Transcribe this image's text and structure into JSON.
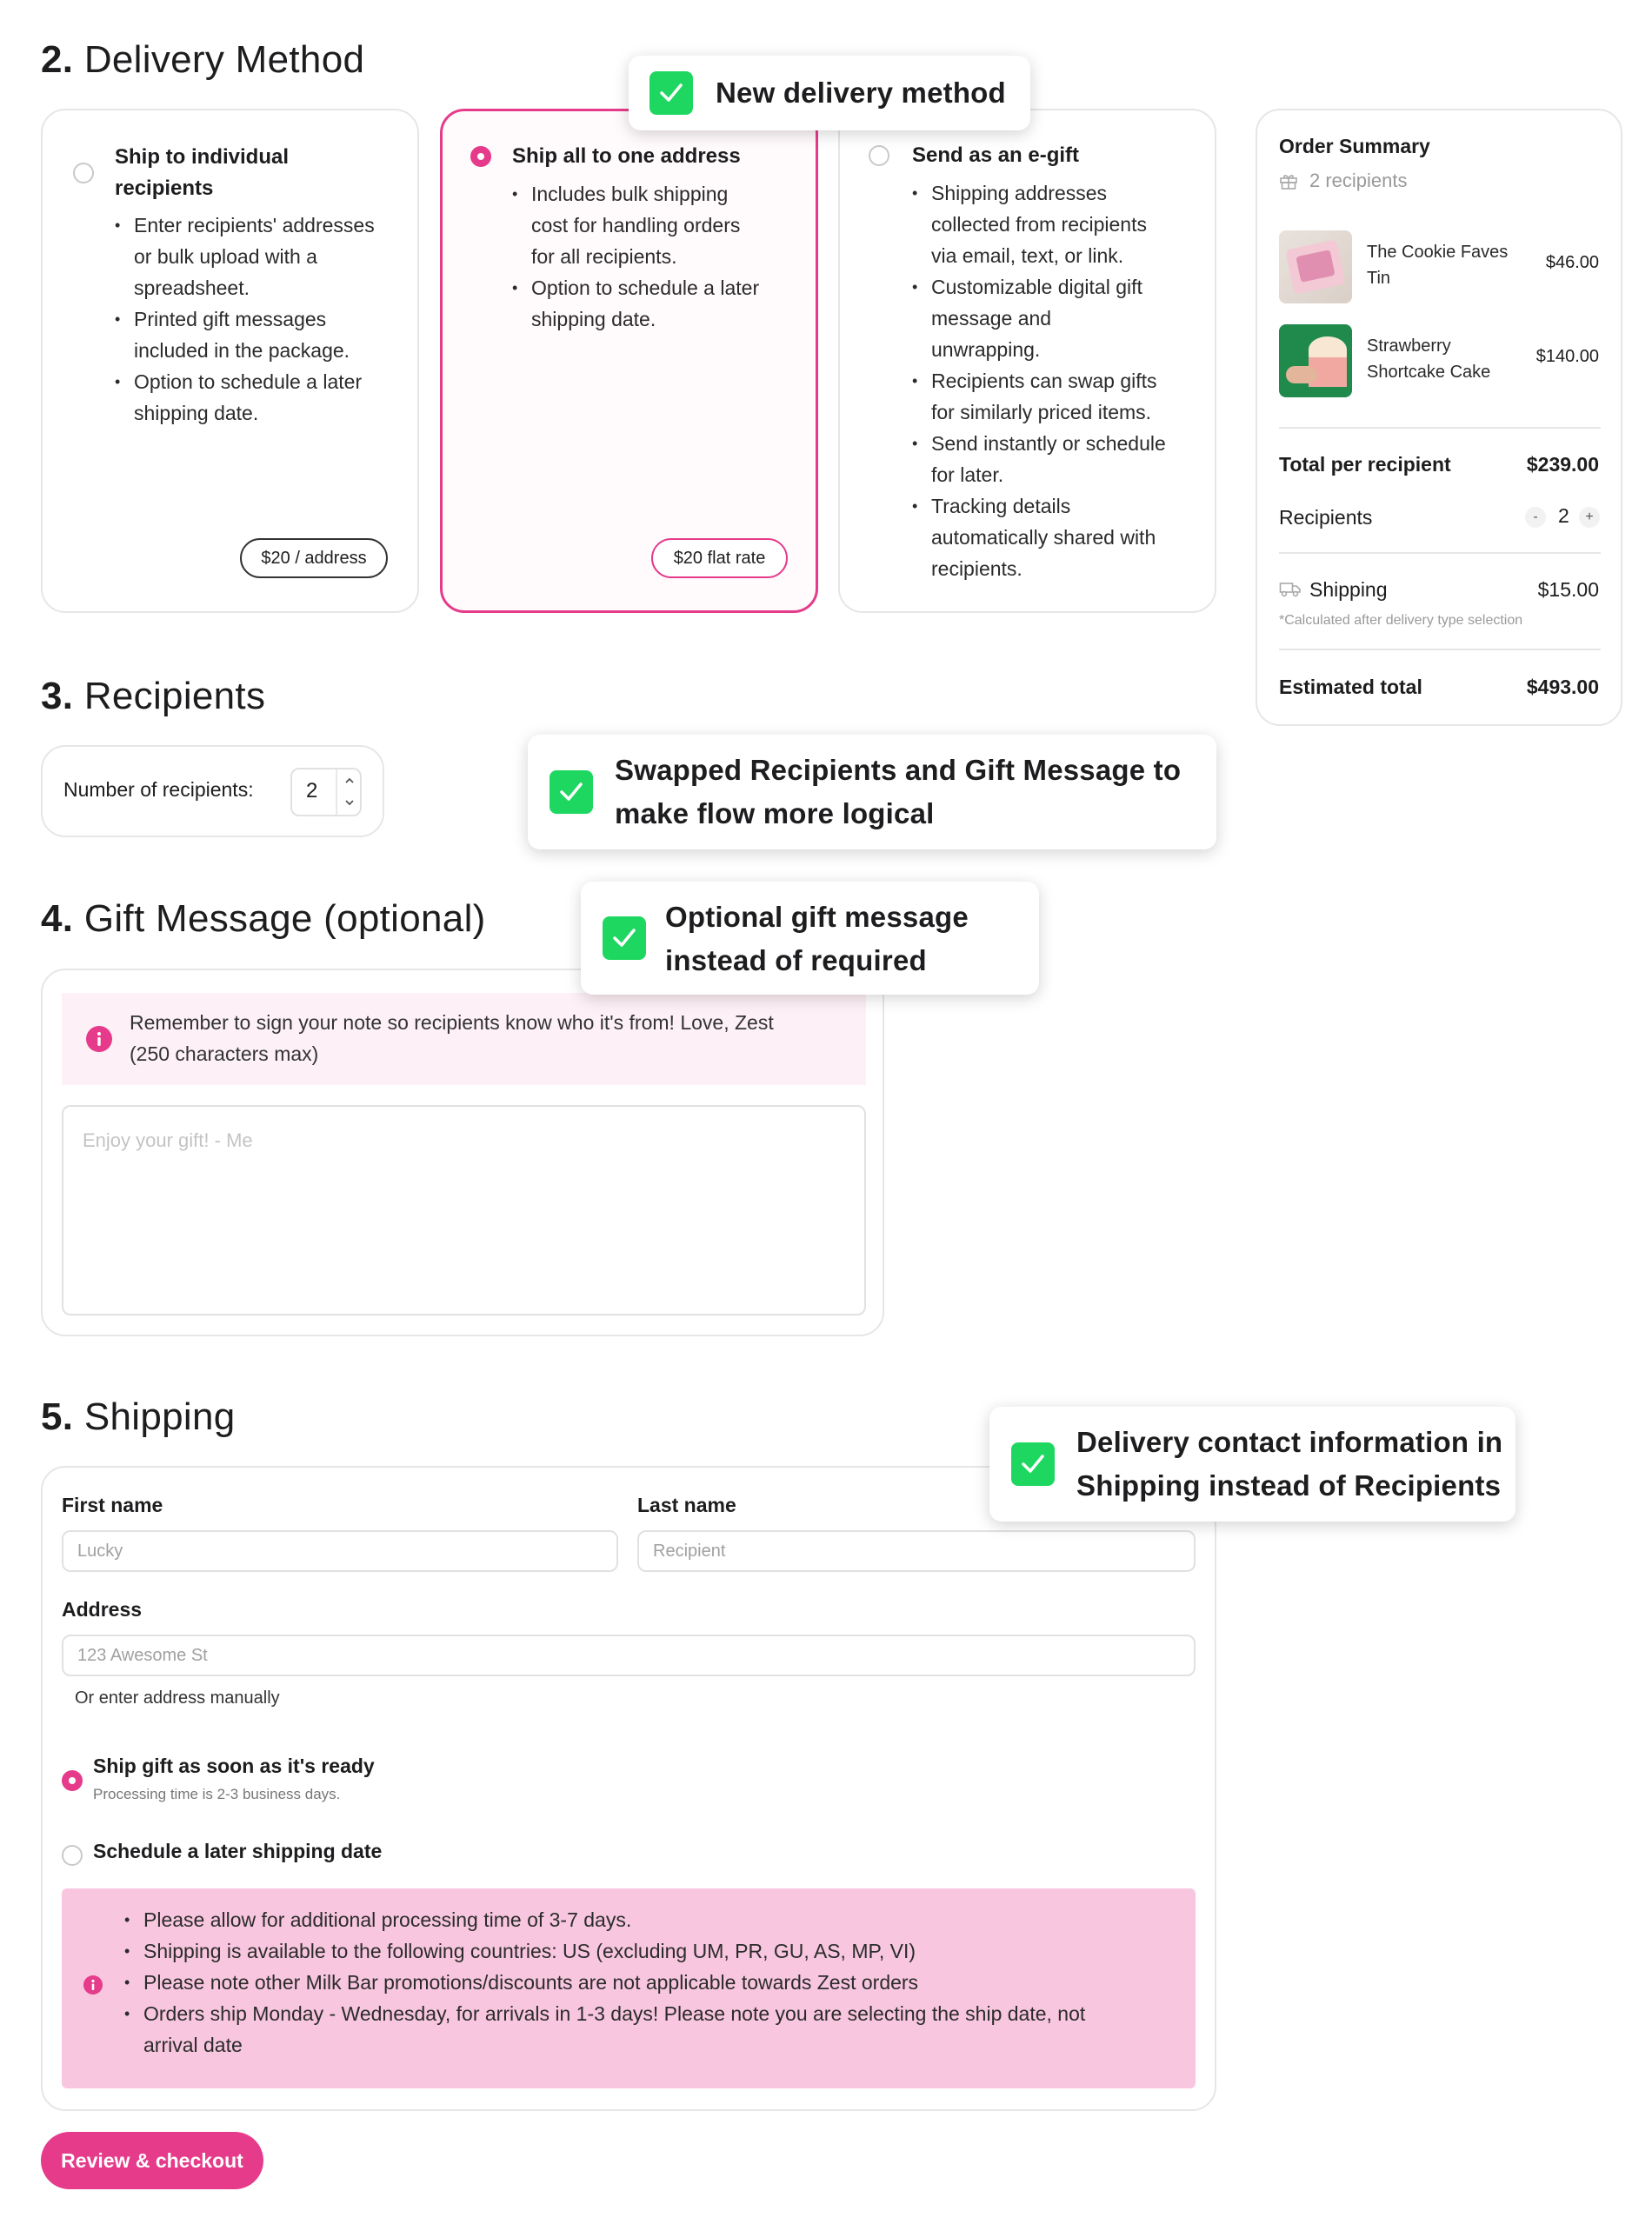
{
  "delivery": {
    "number": "2.",
    "title": "Delivery Method",
    "options": [
      {
        "title_line1": "Ship to individual",
        "title_line2": "recipients",
        "bullets": [
          [
            "Enter recipients' addresses",
            "or bulk upload with a",
            "spreadsheet."
          ],
          [
            "Printed gift messages",
            "included in the package."
          ],
          [
            "Option to schedule a later",
            "shipping date."
          ]
        ],
        "price": "$20 / address",
        "selected": false
      },
      {
        "title_line1": "Ship all to one address",
        "bullets": [
          [
            "Includes bulk shipping",
            "cost for handling orders",
            "for all recipients."
          ],
          [
            "Option to schedule a later",
            "shipping date."
          ]
        ],
        "price": "$20 flat rate",
        "selected": true
      },
      {
        "title_line1": "Send as an e-gift",
        "bullets": [
          [
            "Shipping addresses",
            "collected from recipients",
            "via email, text, or link."
          ],
          [
            "Customizable digital gift",
            "message and",
            "unwrapping."
          ],
          [
            "Recipients can swap gifts",
            "for similarly priced items."
          ],
          [
            "Send instantly or schedule",
            "for later."
          ],
          [
            "Tracking details",
            "automatically shared with",
            "recipients."
          ]
        ],
        "selected": false
      }
    ]
  },
  "recipients": {
    "number": "3.",
    "title": "Recipients",
    "count_label": "Number of recipients:",
    "count_value": "2"
  },
  "gift": {
    "number": "4.",
    "title": "Gift Message (optional)",
    "note_line1": "Remember to sign your note so recipients know who it's from! Love, Zest",
    "note_line2": "(250 characters max)",
    "placeholder": "Enjoy your gift! - Me"
  },
  "shipping": {
    "number": "5.",
    "title": "Shipping",
    "first_name_label": "First name",
    "first_name_placeholder": "Lucky",
    "last_name_label": "Last name",
    "last_name_placeholder": "Recipient",
    "address_label": "Address",
    "address_placeholder": "123 Awesome St",
    "manual_link": "Or enter address manually",
    "option1_title": "Ship gift as soon as it's ready",
    "option1_sub": "Processing time is 2-3 business days.",
    "option2_title": "Schedule a later shipping date",
    "notice_bullets": [
      "Please allow for additional processing time of 3-7 days.",
      "Shipping is available to the following countries: US (excluding UM, PR, GU, AS, MP, VI)",
      "Please note other Milk Bar promotions/discounts are not applicable towards Zest orders",
      "Orders ship Monday - Wednesday, for arrivals in 1-3 days! Please note you are selecting the ship date, not",
      "arrival date"
    ],
    "checkout_label": "Review & checkout"
  },
  "summary": {
    "title": "Order Summary",
    "recipients_text": "2 recipients",
    "items": [
      {
        "name_line1": "The Cookie Faves",
        "name_line2": "Tin",
        "price": "$46.00"
      },
      {
        "name_line1": "Strawberry",
        "name_line2": "Shortcake Cake",
        "price": "$140.00"
      }
    ],
    "total_per_label": "Total per recipient",
    "total_per_value": "$239.00",
    "recipients_label": "Recipients",
    "recipients_minus": "-",
    "recipients_value": "2",
    "recipients_plus": "+",
    "shipping_label": "Shipping",
    "shipping_value": "$15.00",
    "shipping_note": "*Calculated after delivery type selection",
    "estimated_label": "Estimated total",
    "estimated_value": "$493.00"
  },
  "callouts": {
    "c1": "New delivery method",
    "c2_line1": "Swapped Recipients and Gift Message to",
    "c2_line2": "make flow more logical",
    "c3_line1": "Optional gift message",
    "c3_line2": "instead of required",
    "c4_line1": "Delivery contact information in",
    "c4_line2": "Shipping instead of Recipients"
  },
  "colors": {
    "accent": "#e53b8a",
    "check_green": "#1ed760",
    "notice_bg": "#f8c7df",
    "info_bg": "#fdf0f6"
  },
  "icons": [
    "check-icon",
    "info-icon",
    "gift-icon",
    "truck-icon",
    "chevron-up-icon",
    "chevron-down-icon"
  ]
}
